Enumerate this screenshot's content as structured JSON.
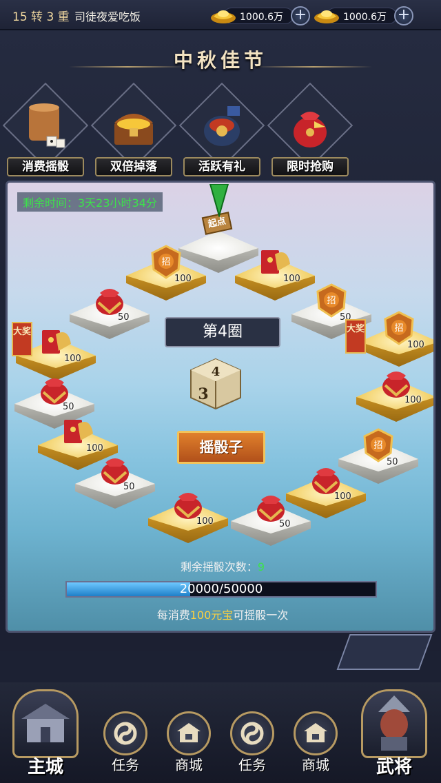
{
  "topbar": {
    "level": "15 转 3 重",
    "player_name": "司徒夜爱吃饭",
    "currencies": [
      {
        "icon": "gold-ingot-icon",
        "value": "1000.6万"
      },
      {
        "icon": "gold-ingot-icon",
        "value": "1000.6万"
      }
    ]
  },
  "event": {
    "title": "中秋佳节",
    "tabs": [
      {
        "label": "消费摇骰",
        "icon": "dice-cup-icon"
      },
      {
        "label": "双倍掉落",
        "icon": "treasure-chest-icon"
      },
      {
        "label": "活跃有礼",
        "icon": "gift-pot-icon"
      },
      {
        "label": "限时抢购",
        "icon": "lucky-bag-icon"
      }
    ]
  },
  "board": {
    "remaining_time": "剩余时间：3天23小时34分",
    "start_label": "起点",
    "round_label": "第4圈",
    "dice_faces": [
      "4",
      "3"
    ],
    "roll_button": "摇骰子",
    "big_prize_label": "大奖",
    "cells": [
      {
        "reward": "100",
        "icon": "recruit-badge-icon"
      },
      {
        "reward": "100",
        "icon": "red-envelope-icon"
      },
      {
        "reward": "50",
        "icon": "recruit-badge-icon"
      },
      {
        "reward": "100",
        "icon": "recruit-badge-icon"
      },
      {
        "reward": "100",
        "icon": "lucky-bag-icon"
      },
      {
        "reward": "50",
        "icon": "recruit-badge-icon"
      },
      {
        "reward": "100",
        "icon": "lucky-bag-icon"
      },
      {
        "reward": "50",
        "icon": "lucky-bag-icon"
      },
      {
        "reward": "100",
        "icon": "red-envelope-icon"
      },
      {
        "reward": "50",
        "icon": "lucky-bag-icon"
      },
      {
        "reward": "100",
        "icon": "red-envelope-icon"
      },
      {
        "reward": "50",
        "icon": "lucky-bag-icon"
      },
      {
        "reward": "100",
        "icon": "lucky-bag-icon"
      },
      {
        "reward": "50",
        "icon": "lucky-bag-icon"
      },
      {
        "reward": "100",
        "icon": "recruit-badge-icon"
      }
    ],
    "remaining_rolls_label": "剩余摇骰次数：",
    "remaining_rolls": "9",
    "progress_text": "20000/50000",
    "progress_current": 20000,
    "progress_max": 50000,
    "cost_prefix": "每消费",
    "cost_amount": "100元宝",
    "cost_suffix": "可摇骰一次"
  },
  "nav": {
    "main_city": "主城",
    "items": [
      "任务",
      "商城",
      "任务",
      "商城"
    ],
    "general": "武将"
  }
}
